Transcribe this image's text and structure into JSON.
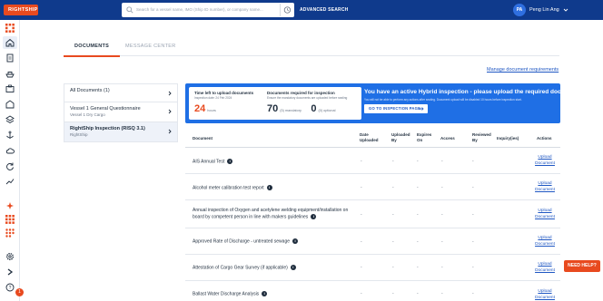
{
  "brand": {
    "logo_text": "RIGHTSHIP"
  },
  "topbar": {
    "search_placeholder": "Search for a vessel name, IMO (Ship ID number), or company name...",
    "advanced_search": "ADVANCED SEARCH",
    "user_initials": "PA",
    "user_name": "Peng Lin Ang"
  },
  "tabs": [
    {
      "label": "DOCUMENTS",
      "active": true
    },
    {
      "label": "MESSAGE CENTER",
      "active": false
    }
  ],
  "manage_link": "Manage document requirements",
  "doc_list": [
    {
      "title": "All Documents (1)",
      "subtitle": ""
    },
    {
      "title": "Vessel 1  General Questionnaire",
      "subtitle": "Vessel 1 Dry Cargo"
    },
    {
      "title": "RightShip Inspection (RISQ 3.1)",
      "subtitle": "RightShip"
    }
  ],
  "banner": {
    "time_title": "Time left to upload documents",
    "time_sub": "Inspection date: 24 Feb 2024",
    "hours_value": "24",
    "hours_unit": "hours",
    "req_title": "Documents required for inspection",
    "req_sub": "Ensure the mandatory documents are uploaded before sealing",
    "mandatory_value": "70",
    "mandatory_unit": "(5) mandatory",
    "optional_value": "0",
    "optional_unit": "(0) optional",
    "headline": "You have an active Hybrid inspection - please upload the required documents",
    "subline": "You will not be able to perform any actions after sealing. Document upload will be disabled 10 hours before inspection start.",
    "button": "GO TO INSPECTION PAGE"
  },
  "table": {
    "headers": {
      "document": "Document",
      "date_uploaded": "Date Uploaded",
      "uploaded_by": "Uploaded By",
      "expires_on": "Expires On",
      "access": "Access",
      "reviewed_by": "Reviewed By",
      "inquiry": "Inquiry(ies)",
      "actions": "Actions"
    },
    "dash": "-",
    "upload_label_1": "Upload",
    "upload_label_2": "Document",
    "rows": [
      {
        "document": "AIS Annual Test"
      },
      {
        "document": "Alcohol meter calibration test report"
      },
      {
        "document": "Annual inspection of Oxygen and acetylene welding equipment/installation on board by competent person in line with makers guidelines"
      },
      {
        "document": "Approved Rate of Discharge - untreated sewage"
      },
      {
        "document": "Attestation of Cargo Gear Survey (if applicable)"
      },
      {
        "document": "Ballast Water Discharge Analysis"
      }
    ]
  },
  "help_button": "NEED HELP?",
  "notification_count": "1",
  "colors": {
    "primary": "#0f3a8c",
    "accent": "#e84a1f",
    "banner": "#1f6fe5",
    "link": "#1f57c3"
  }
}
